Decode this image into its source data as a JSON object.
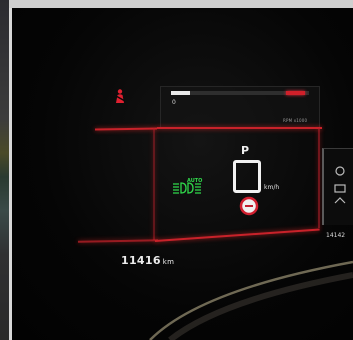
{
  "status": {
    "gear": "P",
    "speed_unit": "km/h",
    "headlight_mode": "AUTO"
  },
  "odometer": {
    "value": "11416",
    "unit": "km"
  },
  "small_readout_top": "RPM x1000",
  "small_readout_left": "0",
  "right_panel_readout": "14142",
  "progress": {
    "white_fraction": 0.14,
    "red_fraction": 0.14
  },
  "icons": {
    "warning": "seat-belt-warning-icon",
    "headlight": "auto-headlight-icon",
    "brake": "parking-brake-icon"
  },
  "colors": {
    "accent_red": "#c8222a",
    "indicator_green": "#2fd84a",
    "text": "#e8e8e8",
    "background": "#050505"
  }
}
